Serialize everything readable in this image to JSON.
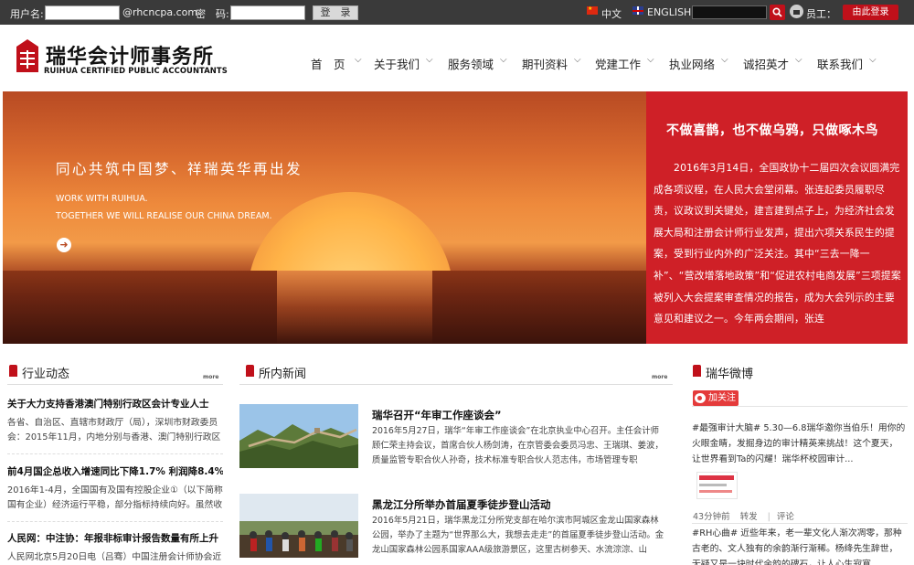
{
  "topbar": {
    "username_label": "用户名:",
    "email_suffix": "@rhcncpa.com",
    "password_label": "密　码:",
    "login_button": "登　录",
    "lang_cn": "中文",
    "lang_en": "ENGLISH",
    "staff_label": "员工：",
    "staff_login_button": "由此登录"
  },
  "header": {
    "logo_cn": "瑞华会计师事务所",
    "logo_en": "RUIHUA CERTIFIED PUBLIC ACCOUNTANTS",
    "nav": [
      "首　页",
      "关于我们",
      "服务领域",
      "期刊资料",
      "党建工作",
      "执业网络",
      "诚招英才",
      "联系我们"
    ]
  },
  "hero": {
    "slogan": "同心共筑中国梦、祥瑞英华再出发",
    "en_line1": "WORK WITH RUIHUA.",
    "en_line2": "TOGETHER WE WILL REALISE OUR CHINA DREAM."
  },
  "feature": {
    "title": "不做喜鹊，也不做乌鸦，只做啄木鸟",
    "body": "2016年3月14日，全国政协十二届四次会议圆满完成各项议程，在人民大会堂闭幕。张连起委员履职尽责，议政议到关键处，建言建到点子上，为经济社会发展大局和注册会计师行业发声，提出六项关系民生的提案，受到行业内外的广泛关注。其中“三去一降一补”、“营改增落地政策”和“促进农村电商发展”三项提案被列入大会提案审查情况的报告，成为大会列示的主要意见和建议之一。今年两会期间，张连"
  },
  "industry": {
    "title": "行业动态",
    "more": "more",
    "items": [
      {
        "title": "关于大力支持香港澳门特别行政区会计专业人士",
        "desc": "各省、自治区、直辖市财政厅（局），深圳市财政委员会：2015年11月，内地分别与香港、澳门特别行政区"
      },
      {
        "title": "前4月国企总收入增速同比下降1.7% 利润降8.4%",
        "desc": "2016年1-4月，全国国有及国有控股企业①（以下简称国有企业）经济运行平稳，部分指标持续向好。虽然收"
      },
      {
        "title": "人民网：中注协：年报非标审计报告数量有所上升",
        "desc": "人民网北京5月20日电（吕骞）中国注册会计师协会近"
      }
    ]
  },
  "news": {
    "title": "所内新闻",
    "more": "more",
    "items": [
      {
        "title": "瑞华召开“年审工作座谈会”",
        "desc": "2016年5月27日，瑞华“年审工作座谈会”在北京执业中心召开。主任会计师顾仁荣主持会议，首席合伙人杨剑涛，在京管委会委员冯忠、王瑞琪、姜波，质量监管专职合伙人孙奇，技术标准专职合伙人范志伟，市场管理专职"
      },
      {
        "title": "黑龙江分所举办首届夏季徒步登山活动",
        "desc": "2016年5月21日，瑞华黑龙江分所党支部在哈尔滨市阿城区金龙山国家森林公园，举办了主题为“世界那么大，我想去走走”的首届夏季徒步登山活动。金龙山国家森林公园系国家AAA级旅游景区，这里古树参天、水流淙淙、山"
      }
    ]
  },
  "weibo": {
    "title": "瑞华微博",
    "follow": "加关注",
    "post1": "#最强审计大脑# 5.30—6.8瑞华邀你当伯乐！用你的火眼金睛，发掘身边的审计精英来挑战！这个夏天，让世界看到Ta的闪耀！瑞华杯校园审计...",
    "meta": [
      "43分钟前",
      "转发",
      "评论"
    ],
    "post2": "#RH心曲# 近些年来，老一辈文化人渐次凋零，那种古老的、文人独有的余韵渐行渐稀。杨绛先生辞世，无疑又是一块时代余韵的碑石，让人心生寂寞..."
  }
}
